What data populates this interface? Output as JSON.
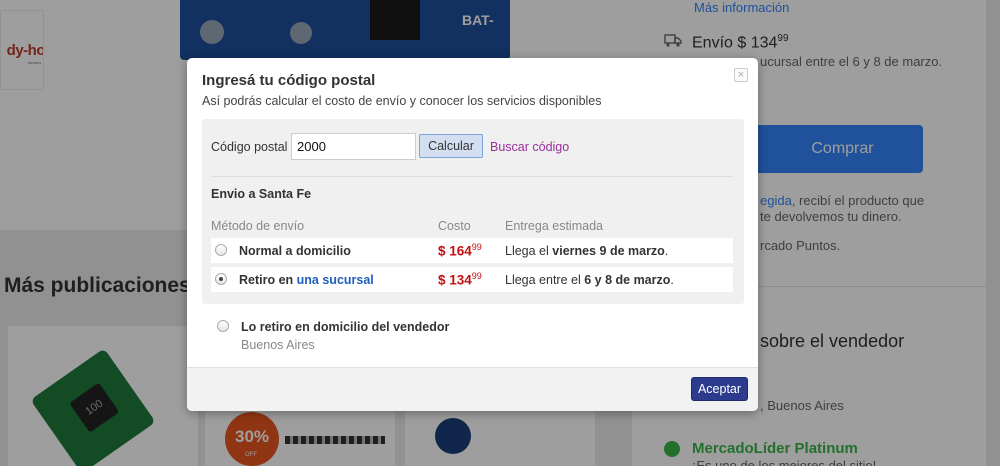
{
  "background": {
    "logo_text": "dy-ho",
    "logo_sub": "TRONICS",
    "board_label": "BAT-",
    "section_title": "Más publicaciones",
    "discount_badge": "30%",
    "discount_sub": "OFF",
    "pcb_label": "100",
    "right": {
      "more_info_link": "Más información",
      "shipping_label": "Envío $ 134",
      "shipping_cents": "99",
      "sucursal_text": "ucursal entre el 6 y 8 de marzo.",
      "buy_button": "Comprar",
      "protected_prefix": "",
      "protected_link": "egida",
      "protected_text": ", recibí el producto que",
      "protected_text2": "te devolvemos tu dinero.",
      "points_text": "rcado Puntos.",
      "seller_title": "sobre el vendedor",
      "seller_location": ", Buenos Aires",
      "lider_title": "MercadoLíder Platinum",
      "lider_sub": "¡Es uno de los mejores del sitio!"
    }
  },
  "modal": {
    "title": "Ingresá tu código postal",
    "subtitle": "Así podrás calcular el costo de envío y conocer los servicios disponibles",
    "close_icon": "×",
    "postal_label": "Código postal",
    "postal_value": "2000",
    "calc_button": "Calcular",
    "search_link": "Buscar código",
    "section_title": "Envio a Santa Fe",
    "headers": {
      "method": "Método de envío",
      "cost": "Costo",
      "delivery": "Entrega estimada"
    },
    "options": [
      {
        "name": "Normal a domicilio",
        "name_link": "",
        "price": "$ 164",
        "cents": "99",
        "eta_prefix": "Llega el ",
        "eta_bold": "viernes 9 de marzo",
        "eta_suffix": ".",
        "selected": false
      },
      {
        "name": "Retiro en ",
        "name_link": "una sucursal",
        "price": "$ 134",
        "cents": "99",
        "eta_prefix": "Llega entre el ",
        "eta_bold": "6 y 8 de marzo",
        "eta_suffix": ".",
        "selected": true
      }
    ],
    "extra_option": {
      "name": "Lo retiro en domicilio del vendedor",
      "location": "Buenos Aires",
      "selected": false
    },
    "accept_button": "Aceptar"
  }
}
